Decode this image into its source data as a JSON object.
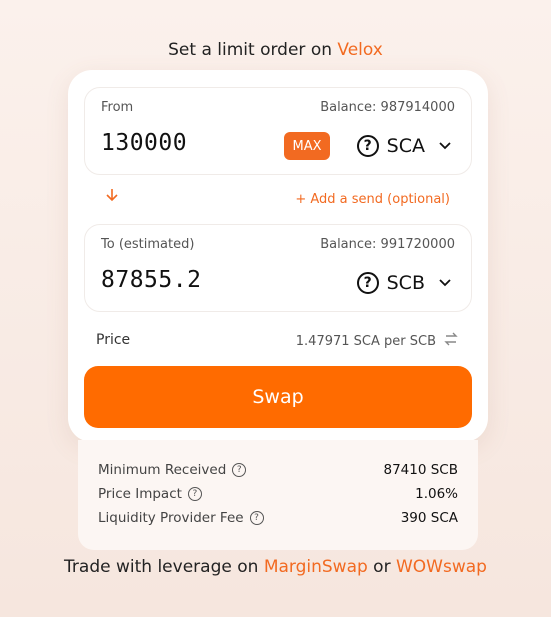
{
  "header": {
    "prefix": "Set a limit order on ",
    "link": "Velox"
  },
  "from": {
    "label": "From",
    "balance": "Balance: 987914000",
    "amount": "130000",
    "max_label": "MAX",
    "token": "SCA"
  },
  "add_send": "+ Add a send (optional)",
  "to": {
    "label": "To (estimated)",
    "balance": "Balance: 991720000",
    "amount": "87855.2",
    "token": "SCB"
  },
  "price": {
    "label": "Price",
    "value": "1.47971 SCA per SCB"
  },
  "swap_label": "Swap",
  "details": [
    {
      "label": "Minimum Received",
      "value": "87410 SCB"
    },
    {
      "label": "Price Impact",
      "value": "1.06%"
    },
    {
      "label": "Liquidity Provider Fee",
      "value": "390 SCA"
    }
  ],
  "footer": {
    "prefix": "Trade with leverage on ",
    "link1": "MarginSwap",
    "middle": " or ",
    "link2": "WOWswap"
  },
  "colors": {
    "accent": "#f26a21",
    "swap_button": "#ff6b00"
  },
  "icons": {
    "token_icon": "question-circle-icon",
    "dropdown": "chevron-down-icon",
    "direction": "arrow-down-icon",
    "invert": "swap-arrows-icon",
    "info": "info-circle-icon"
  }
}
